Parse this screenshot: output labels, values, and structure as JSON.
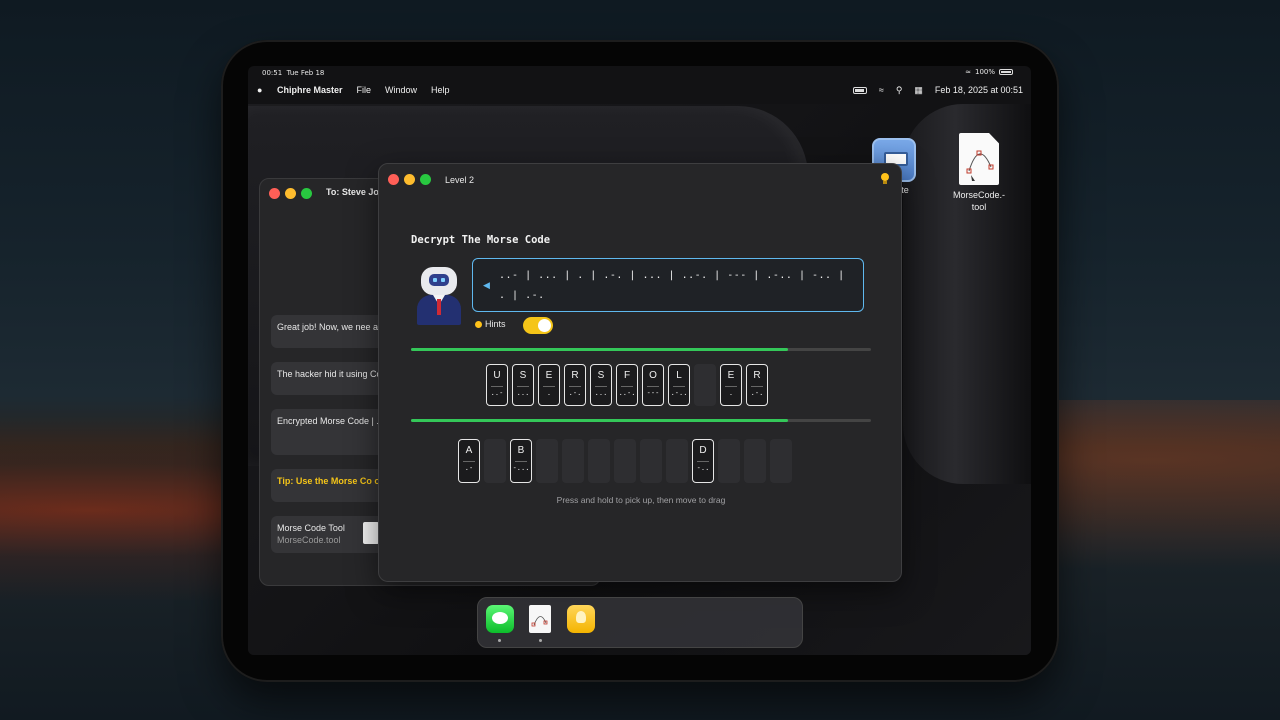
{
  "statusbar": {
    "time": "00:51",
    "date": "Tue Feb 18",
    "battery": "100%"
  },
  "menubar": {
    "app_name": "Chiphre Master",
    "menus": [
      "File",
      "Window",
      "Help"
    ],
    "datetime": "Feb 18, 2025 at 00:51"
  },
  "desktop": {
    "notes_label": "te",
    "tool_label_line1": "MorseCode.-",
    "tool_label_line2": "tool"
  },
  "messages_window": {
    "to": "To: Steve Jo",
    "bubbles": [
      "Great job! Now, we nee attendee list.",
      "The hacker hid it using Code. Decode this to le",
      "Encrypted Morse Code | . | .-. | ... | ..-. | --- | .-. | .-. \""
    ],
    "tip": "Tip: Use the Morse Co on your desktop.",
    "tool_title": "Morse Code Tool",
    "tool_file": "MorseCode.tool"
  },
  "level_window": {
    "title": "Level 2",
    "heading": "Decrypt The Morse Code",
    "morse_text": "..- | ... | . | .-. | ... | ..-. | --- | .-.. | -.. | . | .-.",
    "hints_label": "Hints",
    "hints_on": true,
    "progress_1": 0.82,
    "progress_2": 0.82,
    "answer_tiles": [
      {
        "letter": "U",
        "morse": "..-"
      },
      {
        "letter": "S",
        "morse": "..."
      },
      {
        "letter": "E",
        "morse": "."
      },
      {
        "letter": "R",
        "morse": ".-."
      },
      {
        "letter": "S",
        "morse": "..."
      },
      {
        "letter": "F",
        "morse": "..-."
      },
      {
        "letter": "O",
        "morse": "---"
      },
      {
        "letter": "L",
        "morse": ".-.."
      },
      {
        "letter": "",
        "morse": ""
      },
      {
        "letter": "E",
        "morse": "."
      },
      {
        "letter": "R",
        "morse": ".-."
      }
    ],
    "bank_tiles": [
      {
        "letter": "A",
        "morse": ".-"
      },
      {
        "letter": "",
        "morse": ""
      },
      {
        "letter": "B",
        "morse": "-..."
      },
      {
        "letter": "",
        "morse": ""
      },
      {
        "letter": "",
        "morse": ""
      },
      {
        "letter": "",
        "morse": ""
      },
      {
        "letter": "",
        "morse": ""
      },
      {
        "letter": "",
        "morse": ""
      },
      {
        "letter": "",
        "morse": ""
      },
      {
        "letter": "D",
        "morse": "-.."
      },
      {
        "letter": "",
        "morse": ""
      },
      {
        "letter": "",
        "morse": ""
      },
      {
        "letter": "",
        "morse": ""
      }
    ],
    "drag_hint": "Press and hold to pick up, then move to drag"
  },
  "colors": {
    "accent": "#5fb8ee",
    "progress": "#34c759",
    "toggle": "#f5c518",
    "tip": "#f5c518"
  }
}
